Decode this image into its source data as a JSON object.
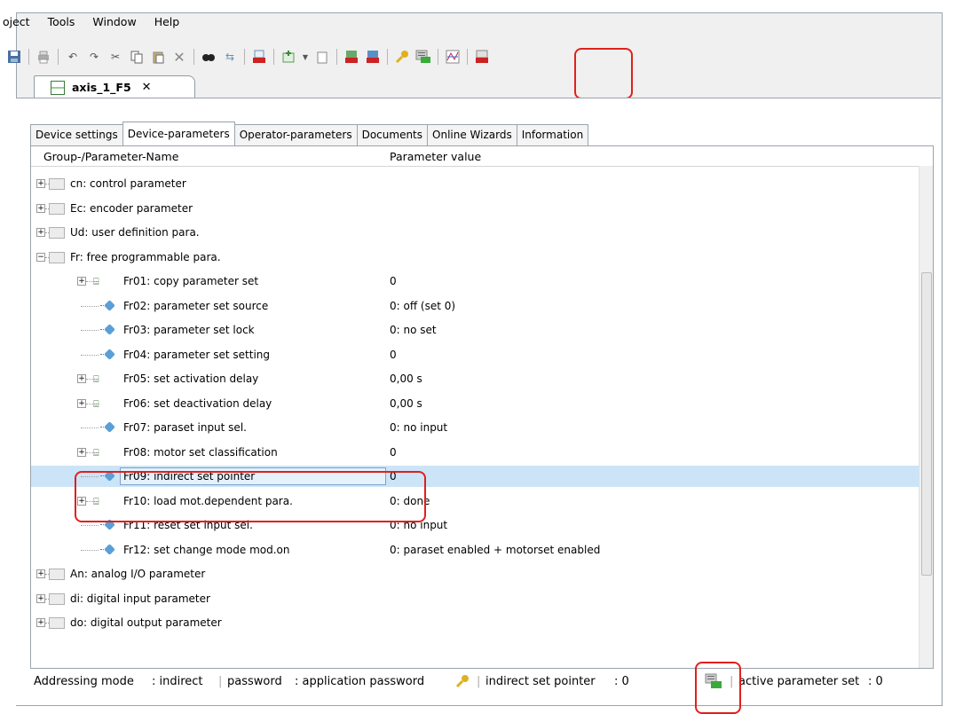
{
  "menu": [
    "oject",
    "Tools",
    "Window",
    "Help"
  ],
  "toolbar_icons": [
    "save-icon",
    "print-icon",
    "undo-icon",
    "redo-icon",
    "cut-icon",
    "copy-icon",
    "paste-icon",
    "delete-icon",
    "find-icon",
    "replace-icon",
    "keb-device-icon",
    "add-device-icon",
    "export-icon",
    "keb-connect-icon",
    "keb-online-icon",
    "password-key-icon",
    "parameter-set-icon",
    "scope-chart-icon",
    "keb-compare-icon"
  ],
  "document_tab": {
    "title": "axis_1_F5",
    "close": "✕"
  },
  "tabs": [
    "Device settings",
    "Device-parameters",
    "Operator-parameters",
    "Documents",
    "Online Wizards",
    "Information"
  ],
  "active_tab": "Device-parameters",
  "columns": {
    "name": "Group-/Parameter-Name",
    "value": "Parameter value"
  },
  "rows": [
    {
      "name": "cn: control parameter",
      "value": "",
      "kind": "group",
      "level": 0,
      "expander": "+"
    },
    {
      "name": "Ec: encoder parameter",
      "value": "",
      "kind": "group",
      "level": 0,
      "expander": "+"
    },
    {
      "name": "Ud: user definition para.",
      "value": "",
      "kind": "group",
      "level": 0,
      "expander": "+"
    },
    {
      "name": "Fr: free programmable para.",
      "value": "",
      "kind": "group",
      "level": 0,
      "expander": "−"
    },
    {
      "name": "Fr01: copy parameter set",
      "value": "0",
      "kind": "array",
      "level": 1,
      "expander": "+"
    },
    {
      "name": "Fr02: parameter set source",
      "value": "0: off (set 0)",
      "kind": "param",
      "level": 1
    },
    {
      "name": "Fr03: parameter set lock",
      "value": "0: no set",
      "kind": "param",
      "level": 1
    },
    {
      "name": "Fr04: parameter set setting",
      "value": "0",
      "kind": "param",
      "level": 1
    },
    {
      "name": "Fr05: set activation delay",
      "value": "0,00 s",
      "kind": "array",
      "level": 1,
      "expander": "+"
    },
    {
      "name": "Fr06: set deactivation delay",
      "value": "0,00 s",
      "kind": "array",
      "level": 1,
      "expander": "+"
    },
    {
      "name": "Fr07: paraset input sel.",
      "value": "0: no input",
      "kind": "param",
      "level": 1
    },
    {
      "name": "Fr08: motor set classification",
      "value": "0",
      "kind": "array",
      "level": 1,
      "expander": "+"
    },
    {
      "name": "Fr09: indirect set pointer",
      "value": "0",
      "kind": "param",
      "level": 1,
      "selected": true
    },
    {
      "name": "Fr10: load mot.dependent para.",
      "value": "0: done",
      "kind": "array",
      "level": 1,
      "expander": "+"
    },
    {
      "name": "Fr11: reset set input sel.",
      "value": "0: no input",
      "kind": "param",
      "level": 1
    },
    {
      "name": "Fr12: set change mode mod.on",
      "value": "0: paraset enabled + motorset enabled",
      "kind": "param",
      "level": 1
    },
    {
      "name": "An: analog I/O parameter",
      "value": "",
      "kind": "group",
      "level": 0,
      "expander": "+"
    },
    {
      "name": "di: digital input parameter",
      "value": "",
      "kind": "group",
      "level": 0,
      "expander": "+"
    },
    {
      "name": "do: digital output parameter",
      "value": "",
      "kind": "group",
      "level": 0,
      "expander": "+"
    }
  ],
  "status": {
    "addressing_label": "Addressing mode",
    "addressing_value": ": indirect",
    "password_label": "password",
    "password_value": ": application password",
    "pointer_label": "indirect set pointer",
    "pointer_value": ": 0",
    "active_label": "active parameter set",
    "active_value": ": 0"
  },
  "colors": {
    "selection": "#cce4f7",
    "highlight": "#e0201c",
    "keb_red": "#cc2222"
  }
}
